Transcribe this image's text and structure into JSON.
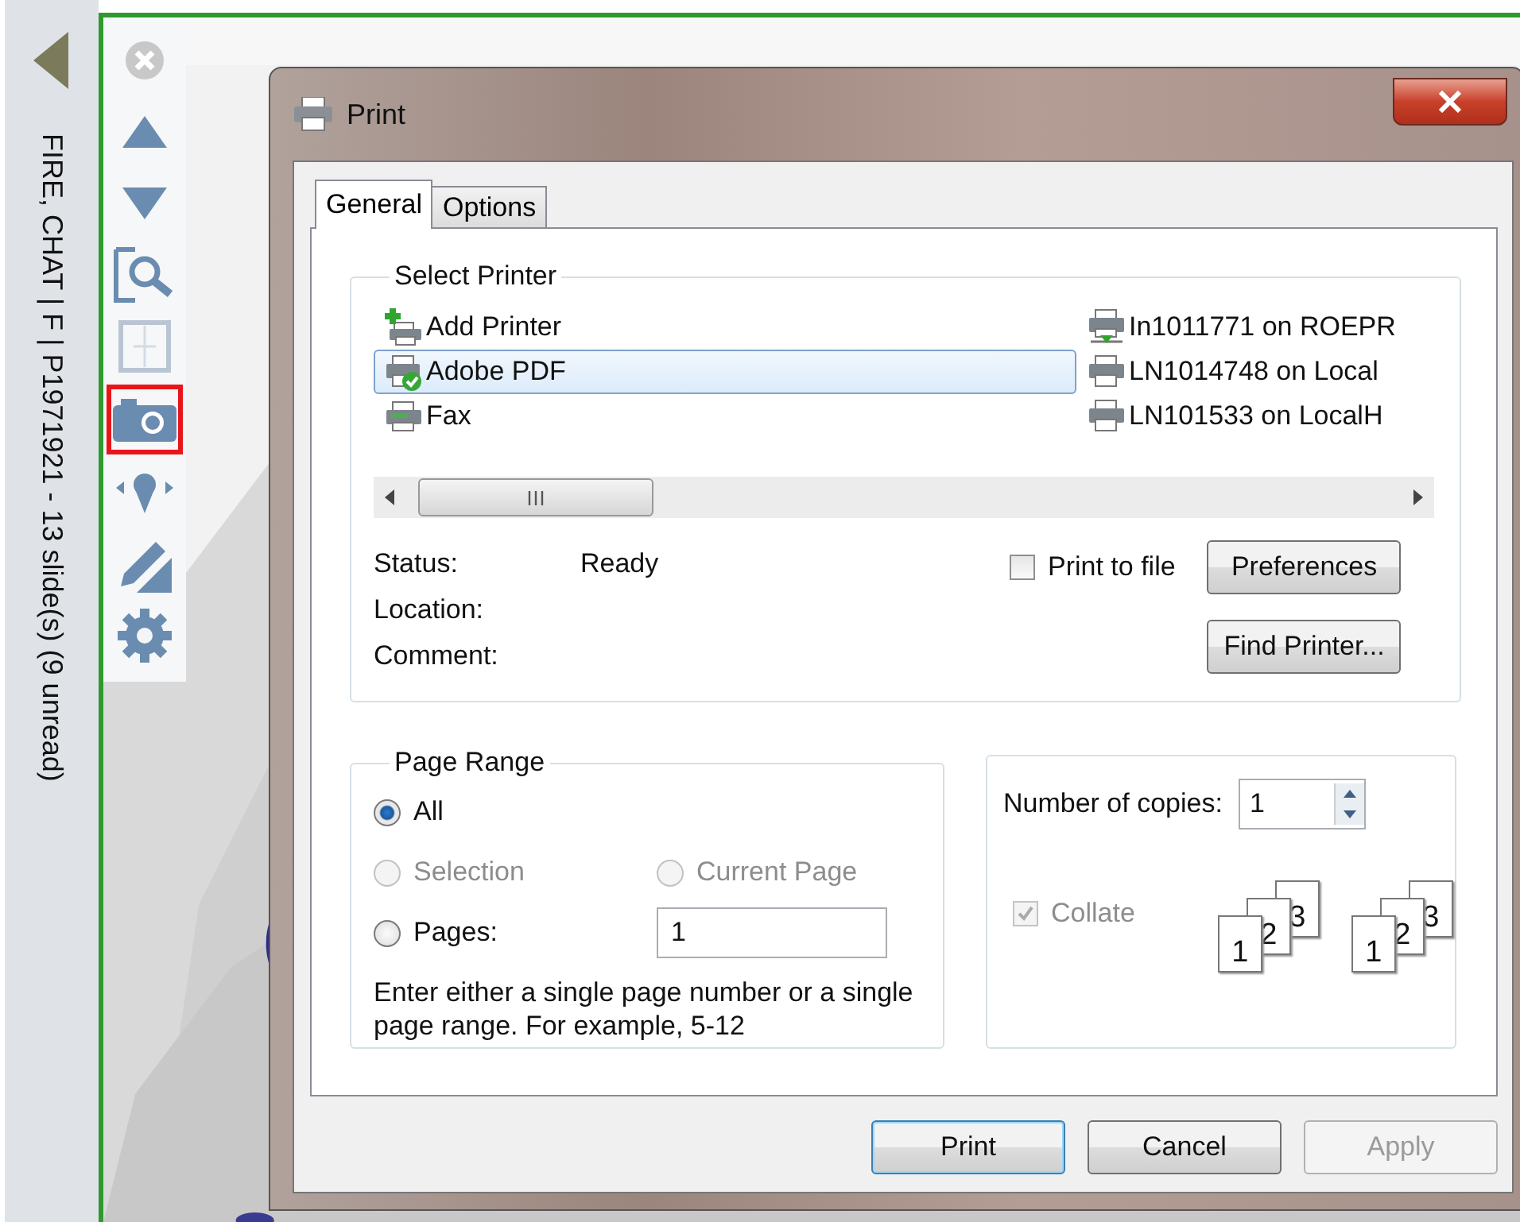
{
  "sidebar": {
    "title": "FIRE, CHAT | F | P1971921 - 13 slide(s) (9 unread)"
  },
  "toolbar": {
    "items": [
      {
        "kind": "close",
        "selected": false
      },
      {
        "kind": "up",
        "selected": false
      },
      {
        "kind": "down",
        "selected": false
      },
      {
        "kind": "zoom",
        "selected": false
      },
      {
        "kind": "layout",
        "selected": false
      },
      {
        "kind": "camera",
        "selected": true
      },
      {
        "kind": "pin",
        "selected": false
      },
      {
        "kind": "pencil",
        "selected": false
      },
      {
        "kind": "gear",
        "selected": false
      }
    ]
  },
  "dialog": {
    "title": "Print",
    "tabs": [
      {
        "label": "General",
        "selected": true
      },
      {
        "label": "Options",
        "selected": false
      }
    ],
    "select_printer": {
      "title": "Select Printer",
      "printers": [
        {
          "name": "Add Printer",
          "kind": "add",
          "selected": false
        },
        {
          "name": "Adobe PDF",
          "kind": "default",
          "selected": true
        },
        {
          "name": "Fax",
          "kind": "fax",
          "selected": false
        },
        {
          "name": "In1011771 on ROEPR",
          "kind": "network",
          "selected": false
        },
        {
          "name": "LN1014748 on Local",
          "kind": "printer",
          "selected": false
        },
        {
          "name": "LN101533 on LocalH",
          "kind": "printer",
          "selected": false
        }
      ],
      "info": [
        {
          "label": "Status:",
          "value": "Ready"
        },
        {
          "label": "Location:"
        },
        {
          "label": "Comment:"
        }
      ],
      "print_to_file": {
        "label": "Print to file",
        "checked": false
      },
      "buttons": [
        "Preferences",
        "Find Printer..."
      ]
    },
    "page_range": {
      "title": "Page Range",
      "options": [
        {
          "label": "All",
          "selected": true,
          "disabled": false
        },
        {
          "label": "Selection",
          "selected": false,
          "disabled": true
        },
        {
          "label": "Current Page",
          "selected": false,
          "disabled": true
        },
        {
          "label": "Pages:",
          "selected": false,
          "disabled": false
        }
      ],
      "pages_value": "1",
      "hint": "Enter either a single page number or a single page range.  For example, 5-12"
    },
    "copies": {
      "label": "Number of copies:",
      "value": "1",
      "collate": {
        "label": "Collate",
        "checked": true,
        "disabled": true
      },
      "stacks": [
        [
          "1",
          "2",
          "3"
        ],
        [
          "1",
          "2",
          "3"
        ]
      ]
    },
    "buttons": [
      {
        "label": "Print",
        "default": true,
        "disabled": false
      },
      {
        "label": "Cancel",
        "default": false,
        "disabled": false
      },
      {
        "label": "Apply",
        "default": false,
        "disabled": true
      }
    ]
  }
}
